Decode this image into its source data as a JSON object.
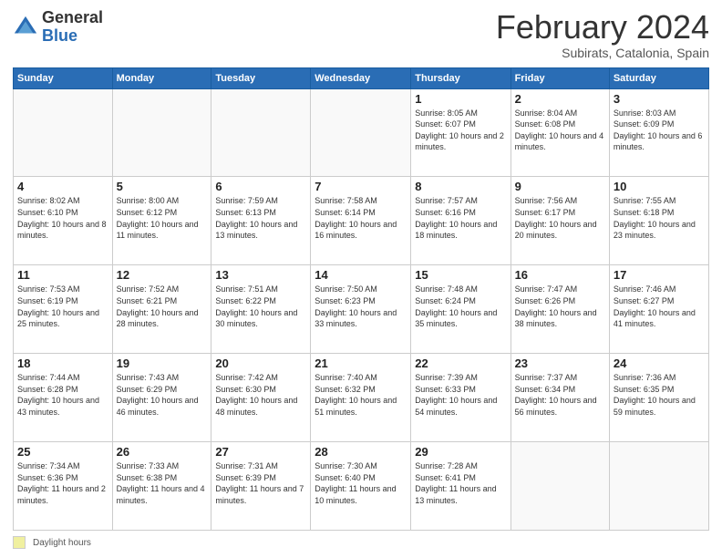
{
  "logo": {
    "general": "General",
    "blue": "Blue"
  },
  "header": {
    "month_year": "February 2024",
    "location": "Subirats, Catalonia, Spain"
  },
  "days_of_week": [
    "Sunday",
    "Monday",
    "Tuesday",
    "Wednesday",
    "Thursday",
    "Friday",
    "Saturday"
  ],
  "footer": {
    "daylight_label": "Daylight hours"
  },
  "weeks": [
    {
      "days": [
        {
          "num": "",
          "sunrise": "",
          "sunset": "",
          "daylight": "",
          "empty": true
        },
        {
          "num": "",
          "sunrise": "",
          "sunset": "",
          "daylight": "",
          "empty": true
        },
        {
          "num": "",
          "sunrise": "",
          "sunset": "",
          "daylight": "",
          "empty": true
        },
        {
          "num": "",
          "sunrise": "",
          "sunset": "",
          "daylight": "",
          "empty": true
        },
        {
          "num": "1",
          "sunrise": "Sunrise: 8:05 AM",
          "sunset": "Sunset: 6:07 PM",
          "daylight": "Daylight: 10 hours and 2 minutes.",
          "empty": false
        },
        {
          "num": "2",
          "sunrise": "Sunrise: 8:04 AM",
          "sunset": "Sunset: 6:08 PM",
          "daylight": "Daylight: 10 hours and 4 minutes.",
          "empty": false
        },
        {
          "num": "3",
          "sunrise": "Sunrise: 8:03 AM",
          "sunset": "Sunset: 6:09 PM",
          "daylight": "Daylight: 10 hours and 6 minutes.",
          "empty": false
        }
      ]
    },
    {
      "days": [
        {
          "num": "4",
          "sunrise": "Sunrise: 8:02 AM",
          "sunset": "Sunset: 6:10 PM",
          "daylight": "Daylight: 10 hours and 8 minutes.",
          "empty": false
        },
        {
          "num": "5",
          "sunrise": "Sunrise: 8:00 AM",
          "sunset": "Sunset: 6:12 PM",
          "daylight": "Daylight: 10 hours and 11 minutes.",
          "empty": false
        },
        {
          "num": "6",
          "sunrise": "Sunrise: 7:59 AM",
          "sunset": "Sunset: 6:13 PM",
          "daylight": "Daylight: 10 hours and 13 minutes.",
          "empty": false
        },
        {
          "num": "7",
          "sunrise": "Sunrise: 7:58 AM",
          "sunset": "Sunset: 6:14 PM",
          "daylight": "Daylight: 10 hours and 16 minutes.",
          "empty": false
        },
        {
          "num": "8",
          "sunrise": "Sunrise: 7:57 AM",
          "sunset": "Sunset: 6:16 PM",
          "daylight": "Daylight: 10 hours and 18 minutes.",
          "empty": false
        },
        {
          "num": "9",
          "sunrise": "Sunrise: 7:56 AM",
          "sunset": "Sunset: 6:17 PM",
          "daylight": "Daylight: 10 hours and 20 minutes.",
          "empty": false
        },
        {
          "num": "10",
          "sunrise": "Sunrise: 7:55 AM",
          "sunset": "Sunset: 6:18 PM",
          "daylight": "Daylight: 10 hours and 23 minutes.",
          "empty": false
        }
      ]
    },
    {
      "days": [
        {
          "num": "11",
          "sunrise": "Sunrise: 7:53 AM",
          "sunset": "Sunset: 6:19 PM",
          "daylight": "Daylight: 10 hours and 25 minutes.",
          "empty": false
        },
        {
          "num": "12",
          "sunrise": "Sunrise: 7:52 AM",
          "sunset": "Sunset: 6:21 PM",
          "daylight": "Daylight: 10 hours and 28 minutes.",
          "empty": false
        },
        {
          "num": "13",
          "sunrise": "Sunrise: 7:51 AM",
          "sunset": "Sunset: 6:22 PM",
          "daylight": "Daylight: 10 hours and 30 minutes.",
          "empty": false
        },
        {
          "num": "14",
          "sunrise": "Sunrise: 7:50 AM",
          "sunset": "Sunset: 6:23 PM",
          "daylight": "Daylight: 10 hours and 33 minutes.",
          "empty": false
        },
        {
          "num": "15",
          "sunrise": "Sunrise: 7:48 AM",
          "sunset": "Sunset: 6:24 PM",
          "daylight": "Daylight: 10 hours and 35 minutes.",
          "empty": false
        },
        {
          "num": "16",
          "sunrise": "Sunrise: 7:47 AM",
          "sunset": "Sunset: 6:26 PM",
          "daylight": "Daylight: 10 hours and 38 minutes.",
          "empty": false
        },
        {
          "num": "17",
          "sunrise": "Sunrise: 7:46 AM",
          "sunset": "Sunset: 6:27 PM",
          "daylight": "Daylight: 10 hours and 41 minutes.",
          "empty": false
        }
      ]
    },
    {
      "days": [
        {
          "num": "18",
          "sunrise": "Sunrise: 7:44 AM",
          "sunset": "Sunset: 6:28 PM",
          "daylight": "Daylight: 10 hours and 43 minutes.",
          "empty": false
        },
        {
          "num": "19",
          "sunrise": "Sunrise: 7:43 AM",
          "sunset": "Sunset: 6:29 PM",
          "daylight": "Daylight: 10 hours and 46 minutes.",
          "empty": false
        },
        {
          "num": "20",
          "sunrise": "Sunrise: 7:42 AM",
          "sunset": "Sunset: 6:30 PM",
          "daylight": "Daylight: 10 hours and 48 minutes.",
          "empty": false
        },
        {
          "num": "21",
          "sunrise": "Sunrise: 7:40 AM",
          "sunset": "Sunset: 6:32 PM",
          "daylight": "Daylight: 10 hours and 51 minutes.",
          "empty": false
        },
        {
          "num": "22",
          "sunrise": "Sunrise: 7:39 AM",
          "sunset": "Sunset: 6:33 PM",
          "daylight": "Daylight: 10 hours and 54 minutes.",
          "empty": false
        },
        {
          "num": "23",
          "sunrise": "Sunrise: 7:37 AM",
          "sunset": "Sunset: 6:34 PM",
          "daylight": "Daylight: 10 hours and 56 minutes.",
          "empty": false
        },
        {
          "num": "24",
          "sunrise": "Sunrise: 7:36 AM",
          "sunset": "Sunset: 6:35 PM",
          "daylight": "Daylight: 10 hours and 59 minutes.",
          "empty": false
        }
      ]
    },
    {
      "days": [
        {
          "num": "25",
          "sunrise": "Sunrise: 7:34 AM",
          "sunset": "Sunset: 6:36 PM",
          "daylight": "Daylight: 11 hours and 2 minutes.",
          "empty": false
        },
        {
          "num": "26",
          "sunrise": "Sunrise: 7:33 AM",
          "sunset": "Sunset: 6:38 PM",
          "daylight": "Daylight: 11 hours and 4 minutes.",
          "empty": false
        },
        {
          "num": "27",
          "sunrise": "Sunrise: 7:31 AM",
          "sunset": "Sunset: 6:39 PM",
          "daylight": "Daylight: 11 hours and 7 minutes.",
          "empty": false
        },
        {
          "num": "28",
          "sunrise": "Sunrise: 7:30 AM",
          "sunset": "Sunset: 6:40 PM",
          "daylight": "Daylight: 11 hours and 10 minutes.",
          "empty": false
        },
        {
          "num": "29",
          "sunrise": "Sunrise: 7:28 AM",
          "sunset": "Sunset: 6:41 PM",
          "daylight": "Daylight: 11 hours and 13 minutes.",
          "empty": false
        },
        {
          "num": "",
          "sunrise": "",
          "sunset": "",
          "daylight": "",
          "empty": true
        },
        {
          "num": "",
          "sunrise": "",
          "sunset": "",
          "daylight": "",
          "empty": true
        }
      ]
    }
  ]
}
